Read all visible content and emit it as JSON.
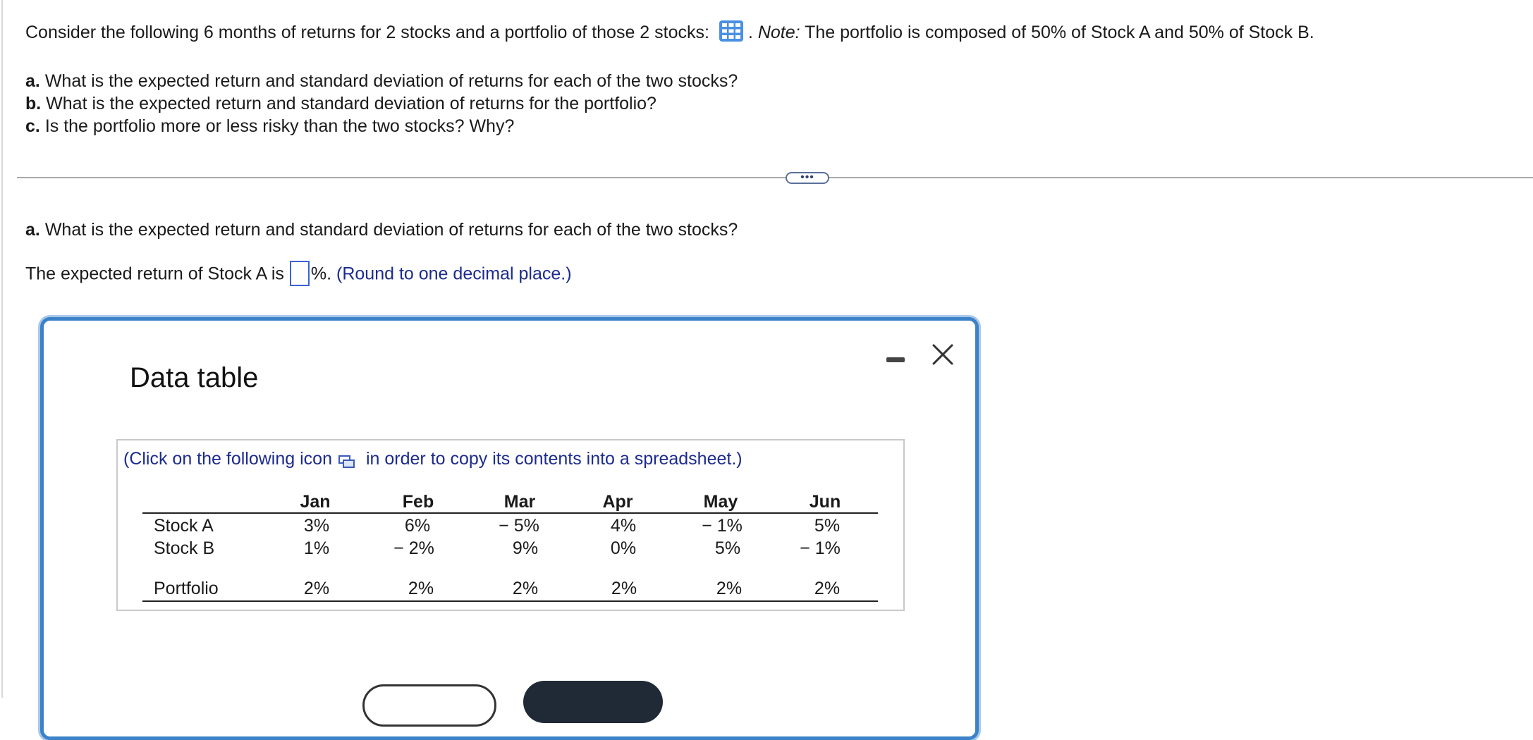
{
  "problem": {
    "intro": "Consider the following 6 months of returns for 2 stocks and a portfolio of those 2 stocks:",
    "note_label": "Note:",
    "note_text": "The portfolio is composed of 50% of Stock A and 50% of Stock B.",
    "questions": [
      {
        "letter": "a.",
        "text": "What is the expected return and standard deviation of returns for each of the two stocks?"
      },
      {
        "letter": "b.",
        "text": "What is the expected return and standard deviation of returns for the portfolio?"
      },
      {
        "letter": "c.",
        "text": "Is the portfolio more or less risky than the two stocks? Why?"
      }
    ]
  },
  "more_button_label": "•••",
  "part": {
    "letter": "a.",
    "text": "What is the expected return and standard deviation of returns for each of the two stocks?",
    "answer_prefix": "The expected return of Stock A is",
    "answer_suffix": "%.",
    "answer_value": "",
    "rounding_hint": "(Round to one decimal place.)"
  },
  "dialog": {
    "title": "Data table",
    "copy_note_before": "(Click on the following icon",
    "copy_note_after": "in order to copy its contents into a spreadsheet.)",
    "table": {
      "columns": [
        "Jan",
        "Feb",
        "Mar",
        "Apr",
        "May",
        "Jun"
      ],
      "rows": [
        {
          "label": "Stock A",
          "values": [
            "3%",
            "6%",
            "− 5%",
            "4%",
            "− 1%",
            "5%"
          ]
        },
        {
          "label": "Stock B",
          "values": [
            "1%",
            "− 2%",
            "9%",
            "0%",
            "5%",
            "− 1%"
          ]
        },
        {
          "label": "Portfolio",
          "values": [
            "2%",
            "2%",
            "2%",
            "2%",
            "2%",
            "2%"
          ]
        }
      ]
    }
  },
  "colors": {
    "link_blue": "#1c2b8f",
    "dialog_border": "#3b82c8",
    "input_border": "#3a63d6",
    "dark_button": "#1f2a36"
  },
  "icons": [
    "data-grid-icon",
    "copy-spreadsheet-icon",
    "minimize-icon",
    "close-icon"
  ]
}
